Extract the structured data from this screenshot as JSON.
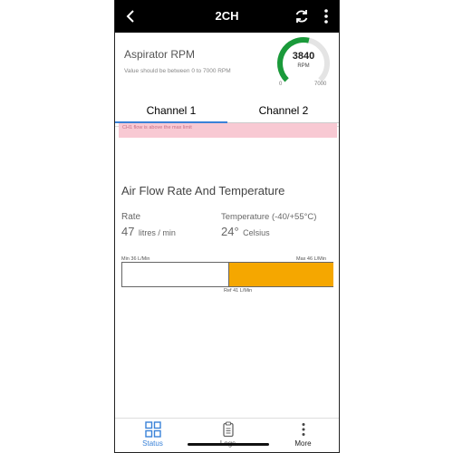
{
  "header": {
    "back_icon": "chevron-left-icon",
    "title": "2CH",
    "refresh_icon": "refresh-icon",
    "more_icon": "kebab-menu-icon"
  },
  "aspirator": {
    "title": "Aspirator RPM",
    "hint": "Value should be between 0 to 7000 RPM",
    "value": "3840",
    "unit": "RPM",
    "min": "0",
    "max": "7000",
    "gauge_color": "#1a9a3a"
  },
  "tabs": [
    {
      "label": "Channel 1",
      "active": true
    },
    {
      "label": "Channel 2",
      "active": false
    }
  ],
  "alert": {
    "text": "CH1 flow is above the max limit",
    "background": "#f8c9d3"
  },
  "airflow": {
    "title": "Air Flow Rate And Temperature",
    "rate_label": "Rate",
    "rate_value": "47",
    "rate_unit": "litres / min",
    "temp_label": "Temperature (-40/+55°C)",
    "temp_value": "24°",
    "temp_unit": "Celsius",
    "bar_min_label": "Min 36 L/Min",
    "bar_max_label": "Max 46 L/Min",
    "bar_ref_label": "Ref 41 L/Min",
    "bar_fill_color": "#f5a700"
  },
  "bottom_nav": [
    {
      "label": "Status",
      "icon": "grid-icon",
      "active": true
    },
    {
      "label": "Logs",
      "icon": "clipboard-icon",
      "active": false
    },
    {
      "label": "More",
      "icon": "dots-vertical-icon",
      "active": false
    }
  ]
}
